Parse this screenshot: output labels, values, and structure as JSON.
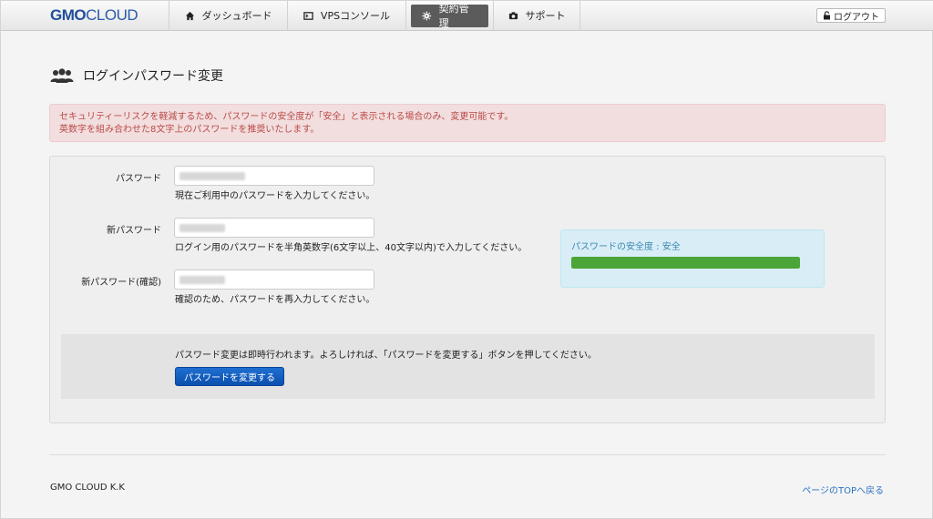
{
  "header": {
    "logo_bold": "GMO",
    "logo_light": "CLOUD",
    "nav": [
      {
        "label": "ダッシュボード",
        "icon": "home-icon"
      },
      {
        "label": "VPSコンソール",
        "icon": "console-icon"
      },
      {
        "label": "契約管理",
        "icon": "gear-icon",
        "active": true
      },
      {
        "label": "サポート",
        "icon": "camera-icon"
      }
    ],
    "logout_label": "ログアウト"
  },
  "page": {
    "title": "ログインパスワード変更",
    "alert_line1": "セキュリティーリスクを軽減するため、パスワードの安全度が「安全」と表示される場合のみ、変更可能です。",
    "alert_line2": "英数字を組み合わせた8文字上のパスワードを推奨いたします。"
  },
  "form": {
    "current": {
      "label": "パスワード",
      "hint": "現在ご利用中のパスワードを入力してください。"
    },
    "new": {
      "label": "新パスワード",
      "hint": "ログイン用のパスワードを半角英数字(6文字以上、40文字以内)で入力してください。"
    },
    "confirm": {
      "label": "新パスワード(確認)",
      "hint": "確認のため、パスワードを再入力してください。"
    },
    "strength_text": "パスワードの安全度 : 安全",
    "strength_level": 1.0,
    "strength_color": "#4ca538",
    "submit_message": "パスワード変更は即時行われます。よろしければ、「パスワードを変更する」ボタンを押してください。",
    "submit_label": "パスワードを変更する"
  },
  "footer": {
    "company": "GMO CLOUD K.K",
    "back_to_top": "ページのTOPへ戻る"
  }
}
